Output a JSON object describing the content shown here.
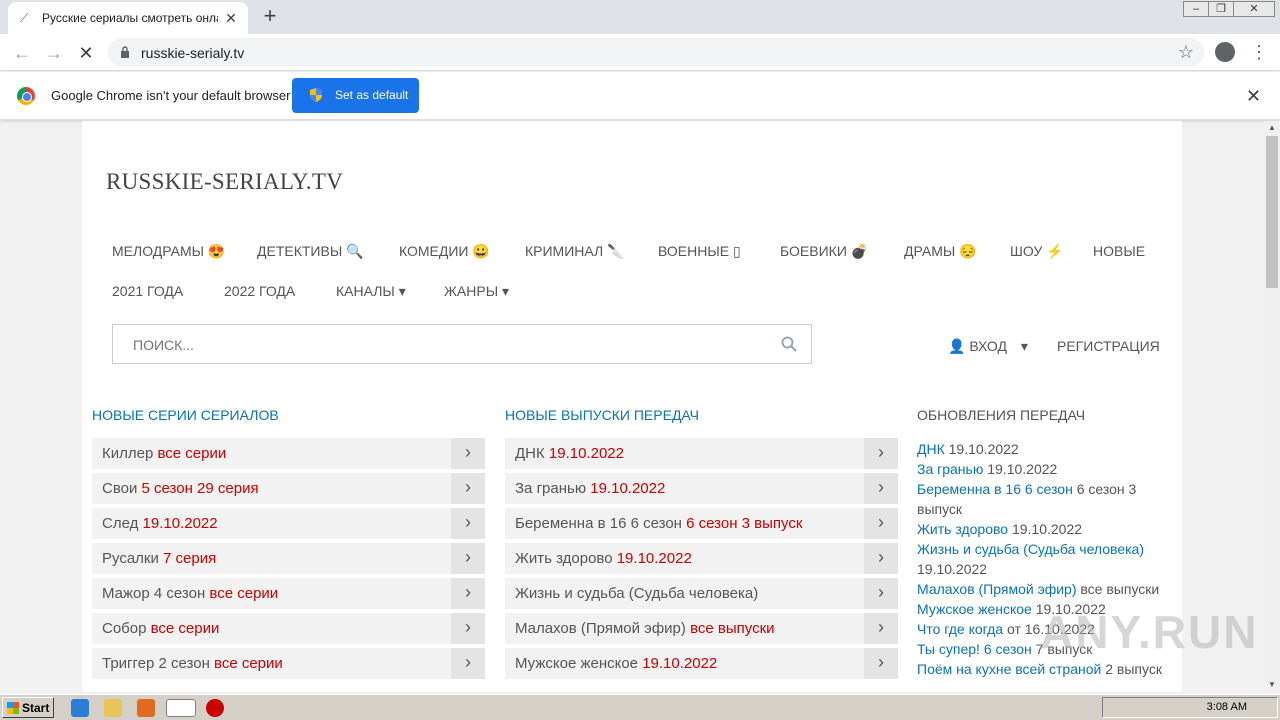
{
  "browser": {
    "tab_title": "Русские сериалы смотреть онлайн",
    "url": "russkie-serialy.tv",
    "infobar_text": "Google Chrome isn't your default browser",
    "set_default_label": "Set as default"
  },
  "site": {
    "title": "RUSSKIE-SERIALY.TV",
    "nav": [
      "МЕЛОДРАМЫ 😍",
      "ДЕТЕКТИВЫ 🔍",
      "КОМЕДИИ 😀",
      "КРИМИНАЛ 🔪",
      "ВОЕННЫЕ ▯",
      "БОЕВИКИ 💣",
      "ДРАМЫ 😔",
      "ШОУ ⚡",
      "НОВЫЕ",
      "2021 ГОДА",
      "2022 ГОДА",
      "КАНАЛЫ ▾",
      "ЖАНРЫ ▾"
    ],
    "search_placeholder": "ПОИСК...",
    "login": "ВХОД",
    "register": "РЕГИСТРАЦИЯ"
  },
  "columns": {
    "series_head": "НОВЫЕ СЕРИИ СЕРИАЛОВ",
    "shows_head": "НОВЫЕ ВЫПУСКИ ПЕРЕДАЧ",
    "updates_head": "ОБНОВЛЕНИЯ ПЕРЕДАЧ"
  },
  "series": [
    {
      "name": "Киллер",
      "tag": "все серии"
    },
    {
      "name": "Свои",
      "tag": "5 сезон 29 серия"
    },
    {
      "name": "След",
      "tag": "19.10.2022"
    },
    {
      "name": "Русалки",
      "tag": "7 серия"
    },
    {
      "name": "Мажор 4 сезон",
      "tag": "все серии"
    },
    {
      "name": "Собор",
      "tag": "все серии"
    },
    {
      "name": "Триггер 2 сезон",
      "tag": "все серии"
    }
  ],
  "shows": [
    {
      "name": "ДНК",
      "tag": "19.10.2022"
    },
    {
      "name": "За гранью",
      "tag": "19.10.2022"
    },
    {
      "name": "Беременна в 16 6 сезон",
      "tag": "6 сезон 3 выпуск"
    },
    {
      "name": "Жить здорово",
      "tag": "19.10.2022"
    },
    {
      "name": "Жизнь и судьба (Судьба человека)",
      "tag": ""
    },
    {
      "name": "Малахов (Прямой эфир)",
      "tag": "все выпуски"
    },
    {
      "name": "Мужское женское",
      "tag": "19.10.2022"
    }
  ],
  "updates": [
    {
      "link": "ДНК",
      "text": "19.10.2022"
    },
    {
      "link": "За гранью",
      "text": "19.10.2022"
    },
    {
      "link": "Беременна в 16 6 сезон",
      "text": "6 сезон 3"
    },
    {
      "link": "",
      "text": "выпуск"
    },
    {
      "link": "Жить здорово",
      "text": "19.10.2022"
    },
    {
      "link": "Жизнь и судьба (Судьба человека)",
      "text": ""
    },
    {
      "link": "",
      "text": "19.10.2022"
    },
    {
      "link": "Малахов (Прямой эфир)",
      "text": "все выпуски"
    },
    {
      "link": "Мужское женское",
      "text": "19.10.2022"
    },
    {
      "link": "Что где когда",
      "text": "от 16.10.2022"
    },
    {
      "link": "Ты супер! 6 сезон",
      "text": "7 выпуск"
    },
    {
      "link": "Поём на кухне всей страной",
      "text": "2 выпуск"
    }
  ],
  "taskbar": {
    "start": "Start",
    "clock": "3:08 AM"
  },
  "watermark": "ANY.RUN"
}
